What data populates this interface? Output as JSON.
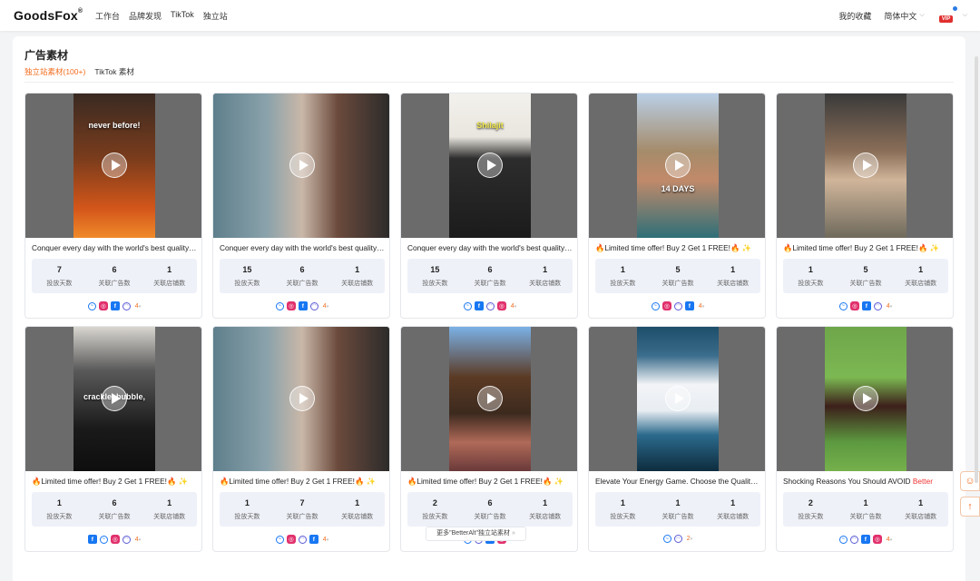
{
  "nav": {
    "logo": "GoodsFox",
    "links": [
      "工作台",
      "品牌发现",
      "TikTok",
      "独立站"
    ],
    "favorites": "我的收藏",
    "language": "简体中文",
    "vip_badge": "VIP"
  },
  "panel": {
    "title": "广告素材",
    "tabs": [
      {
        "label": "独立站素材(100+)",
        "active": true
      },
      {
        "label": "TikTok 素材",
        "active": false
      }
    ]
  },
  "stat_labels": {
    "days": "投放天数",
    "ads": "关联广告数",
    "shops": "关联店铺数"
  },
  "cards": [
    {
      "title": "Conquer every day with the world's best quality shilajit",
      "days": "7",
      "ads": "6",
      "shops": "1",
      "overlay": "never before!",
      "count": "4",
      "icons": [
        "messenger",
        "instagram",
        "facebook",
        "audience"
      ]
    },
    {
      "title": "Conquer every day with the world's best quality shilajit",
      "days": "15",
      "ads": "6",
      "shops": "1",
      "overlay": "",
      "count": "4",
      "icons": [
        "messenger",
        "instagram",
        "facebook",
        "audience"
      ]
    },
    {
      "title": "Conquer every day with the world's best quality shilajit",
      "days": "15",
      "ads": "6",
      "shops": "1",
      "overlay": "Shilajit",
      "count": "4",
      "icons": [
        "messenger",
        "facebook",
        "audience",
        "instagram"
      ]
    },
    {
      "title": "🔥Limited time offer! Buy 2 Get 1 FREE!🔥 ✨",
      "days": "1",
      "ads": "5",
      "shops": "1",
      "overlay": "14 DAYS",
      "count": "4",
      "icons": [
        "messenger",
        "instagram",
        "audience",
        "facebook"
      ]
    },
    {
      "title": "🔥Limited time offer! Buy 2 Get 1 FREE!🔥 ✨",
      "days": "1",
      "ads": "5",
      "shops": "1",
      "overlay": "",
      "count": "4",
      "icons": [
        "messenger",
        "instagram",
        "facebook",
        "audience"
      ]
    },
    {
      "title": "🔥Limited time offer! Buy 2 Get 1 FREE!🔥 ✨",
      "days": "1",
      "ads": "6",
      "shops": "1",
      "overlay": "crackle, bubble,",
      "count": "4",
      "icons": [
        "facebook",
        "messenger",
        "instagram",
        "audience"
      ]
    },
    {
      "title": "🔥Limited time offer! Buy 2 Get 1 FREE!🔥 ✨",
      "days": "1",
      "ads": "7",
      "shops": "1",
      "overlay": "",
      "count": "4",
      "icons": [
        "messenger",
        "instagram",
        "audience",
        "facebook"
      ]
    },
    {
      "title": "🔥Limited time offer! Buy 2 Get 1 FREE!🔥 ✨",
      "days": "2",
      "ads": "6",
      "shops": "1",
      "overlay": "",
      "count": "4",
      "icons": [
        "messenger",
        "audience",
        "facebook",
        "instagram"
      ]
    },
    {
      "title": "Elevate Your Energy Game. Choose the Quality Shilajit",
      "days": "1",
      "ads": "1",
      "shops": "1",
      "overlay": "",
      "count": "2",
      "icons": [
        "messenger",
        "audience"
      ]
    },
    {
      "title": "Shocking Reasons You Should AVOID ",
      "title_hl": "Better",
      "days": "2",
      "ads": "1",
      "shops": "1",
      "overlay": "",
      "count": "4",
      "icons": [
        "messenger",
        "audience",
        "facebook",
        "instagram"
      ]
    }
  ],
  "more_button": "更多\"BetterAlt\"独立站素材",
  "colors": {
    "accent": "#f26c1d",
    "stats_bg": "#eef1f8",
    "thumb_bg": "#6b6b6b"
  }
}
